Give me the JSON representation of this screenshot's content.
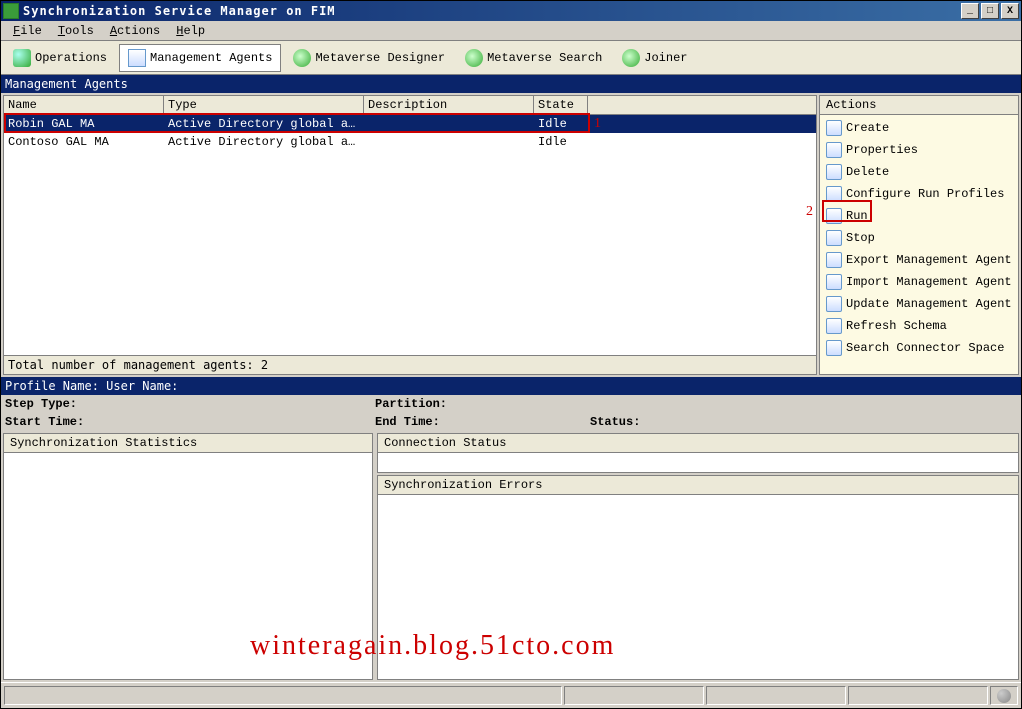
{
  "titlebar": {
    "title": "Synchronization Service Manager on FIM"
  },
  "menu": {
    "file": "File",
    "tools": "Tools",
    "actions": "Actions",
    "help": "Help"
  },
  "toolbar": {
    "operations": "Operations",
    "management_agents": "Management Agents",
    "metaverse_designer": "Metaverse Designer",
    "metaverse_search": "Metaverse Search",
    "joiner": "Joiner"
  },
  "grid": {
    "title": "Management Agents",
    "headers": {
      "name": "Name",
      "type": "Type",
      "description": "Description",
      "state": "State"
    },
    "rows": [
      {
        "name": "Robin GAL MA",
        "type": "Active Directory global addr...",
        "description": "",
        "state": "Idle"
      },
      {
        "name": "Contoso GAL MA",
        "type": "Active Directory global addr...",
        "description": "",
        "state": "Idle"
      }
    ],
    "total": "Total number of management agents: 2"
  },
  "actions": {
    "header": "Actions",
    "items": [
      "Create",
      "Properties",
      "Delete",
      "Configure Run Profiles",
      "Run",
      "Stop",
      "Export Management Agent",
      "Import Management Agent",
      "Update Management Agent",
      "Refresh Schema",
      "Search Connector Space"
    ]
  },
  "profile": {
    "label": "Profile Name:   User Name:"
  },
  "info": {
    "step_type": "Step Type:",
    "start_time": "Start Time:",
    "partition": "Partition:",
    "end_time": "End Time:",
    "status": "Status:"
  },
  "panels": {
    "sync_stats": "Synchronization Statistics",
    "conn_status": "Connection Status",
    "sync_errors": "Synchronization Errors"
  },
  "annotations": {
    "one": "1",
    "two": "2"
  },
  "watermark": "winteragain.blog.51cto.com"
}
